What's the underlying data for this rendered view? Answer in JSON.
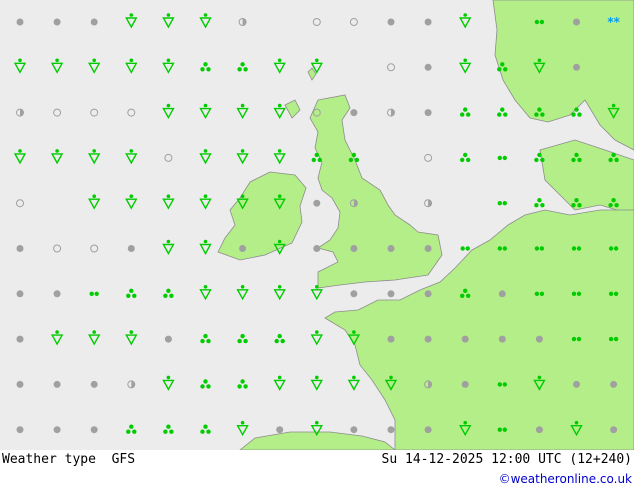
{
  "footer": {
    "label": "Weather type",
    "model": "GFS",
    "valid_time": "Su 14-12-2025 12:00 UTC (12+240)",
    "credit": "©weatheronline.co.uk"
  },
  "colors": {
    "sea": "#ececec",
    "land": "#b4ee88",
    "coast": "#8c8c8c",
    "rain": "#00cc00",
    "snow": "#0099ff",
    "dry": "#a0a0a0"
  },
  "symbol_legend": {
    "d": "dry-dot",
    "c": "cloud-circle",
    "h": "half-cloud",
    "s": "shower",
    "t": "three-drops",
    "r": "two-drops",
    "k": "snow"
  },
  "grid": [
    "dddsssh.ccdds.rdkd",
    "sssssttss.cdstsd.kt",
    "hcccsssscdhdttttsst",
    "sssscssstt.ctrttttr",
    "c.ssssssdh.h.rttttt",
    "dccdssdsddddrrrrrd",
    "ddrttssssdddtdrrrd",
    "dsssdtttssdddddrrrd",
    "dddhsttsssshdrsdddd",
    "dddtttsdsdddsrdsdsd"
  ]
}
